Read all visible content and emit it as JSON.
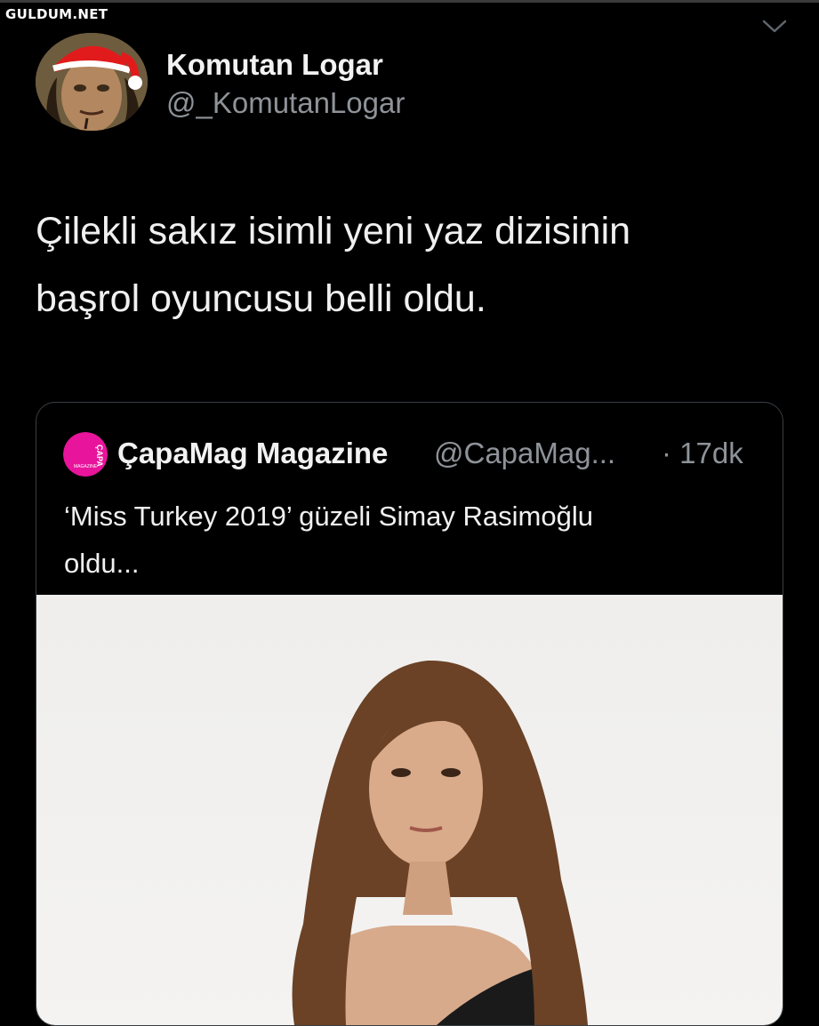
{
  "watermark": "GULDUM.NET",
  "tweet": {
    "author_name": "Komutan Logar",
    "author_handle": "@_KomutanLogar",
    "text_line1": "Çilekli sakız isimli yeni yaz dizisinin",
    "text_line2": "başrol oyuncusu belli oldu."
  },
  "quote": {
    "author_name": "ÇapaMag Magazine",
    "author_handle": "@CapaMag...",
    "time": "· 17dk",
    "text_line1": "‘Miss Turkey 2019’ güzeli Simay Rasimoğlu",
    "text_line2": "oldu...",
    "avatar_text": "ÇAPA",
    "avatar_subtext": "MAGAZINE",
    "avatar_color": "#e8149b"
  },
  "icons": {
    "menu": "chevron-down-icon"
  },
  "colors": {
    "background": "#000000",
    "secondary_text": "#8e9399",
    "card_border": "#3a3f44"
  }
}
